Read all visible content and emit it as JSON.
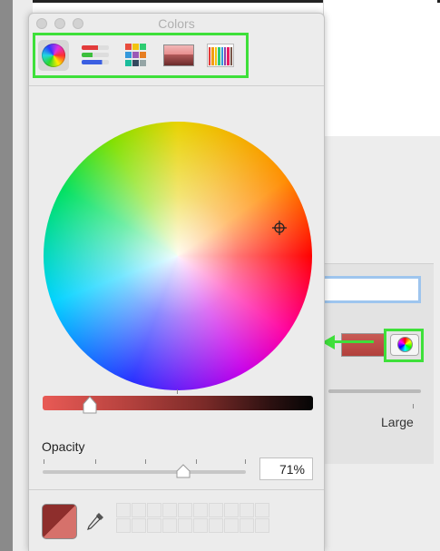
{
  "colors_panel": {
    "title": "Colors",
    "toolbar": [
      {
        "name": "color-wheel-mode",
        "icon": "color-wheel-icon",
        "selected": true
      },
      {
        "name": "color-sliders-mode",
        "icon": "sliders-icon",
        "selected": false
      },
      {
        "name": "color-palettes-mode",
        "icon": "palette-icon",
        "selected": false
      },
      {
        "name": "image-palettes-mode",
        "icon": "image-icon",
        "selected": false
      },
      {
        "name": "pencils-mode",
        "icon": "crayons-icon",
        "selected": false
      }
    ],
    "brightness_level": 0.2,
    "opacity": {
      "label": "Opacity",
      "value_text": "71%",
      "value": 0.71
    },
    "current_color": "#b2403c"
  },
  "background_window": {
    "font_size_max_label": "Large"
  },
  "annotation_color": "#3ee03a"
}
